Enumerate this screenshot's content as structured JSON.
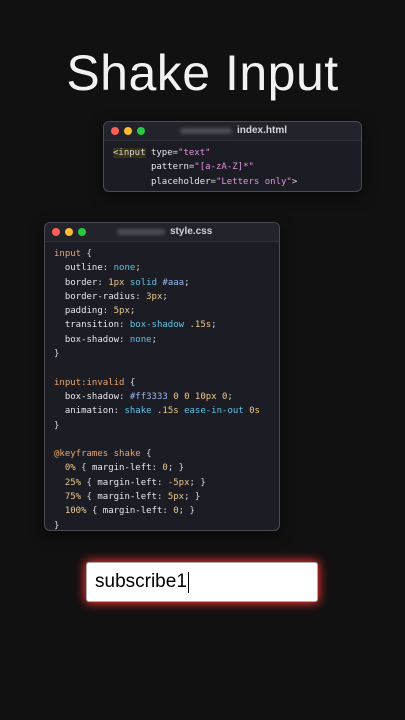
{
  "title": "Shake Input",
  "html_window": {
    "filename": "index.html",
    "lines": [
      [
        [
          "tag",
          "<input"
        ],
        [
          "plain",
          " "
        ],
        [
          "attr",
          "type"
        ],
        [
          "plain",
          "="
        ],
        [
          "str",
          "\"text\""
        ]
      ],
      [
        [
          "plain",
          "       "
        ],
        [
          "attr",
          "pattern"
        ],
        [
          "plain",
          "="
        ],
        [
          "str",
          "\"[a-zA-Z]*\""
        ]
      ],
      [
        [
          "plain",
          "       "
        ],
        [
          "attr",
          "placeholder"
        ],
        [
          "plain",
          "="
        ],
        [
          "str",
          "\"Letters only\""
        ],
        [
          "plain",
          ">"
        ]
      ]
    ]
  },
  "css_window": {
    "filename": "style.css",
    "lines": [
      [
        [
          "sel",
          "input"
        ],
        [
          "plain",
          " {"
        ]
      ],
      [
        [
          "plain",
          "  "
        ],
        [
          "prop",
          "outline"
        ],
        [
          "plain",
          ": "
        ],
        [
          "val",
          "none"
        ],
        [
          "plain",
          ";"
        ]
      ],
      [
        [
          "plain",
          "  "
        ],
        [
          "prop",
          "border"
        ],
        [
          "plain",
          ": "
        ],
        [
          "num",
          "1px"
        ],
        [
          "plain",
          " "
        ],
        [
          "val",
          "solid"
        ],
        [
          "plain",
          " "
        ],
        [
          "hex",
          "#aaa"
        ],
        [
          "plain",
          ";"
        ]
      ],
      [
        [
          "plain",
          "  "
        ],
        [
          "prop",
          "border-radius"
        ],
        [
          "plain",
          ": "
        ],
        [
          "num",
          "3px"
        ],
        [
          "plain",
          ";"
        ]
      ],
      [
        [
          "plain",
          "  "
        ],
        [
          "prop",
          "padding"
        ],
        [
          "plain",
          ": "
        ],
        [
          "num",
          "5px"
        ],
        [
          "plain",
          ";"
        ]
      ],
      [
        [
          "plain",
          "  "
        ],
        [
          "prop",
          "transition"
        ],
        [
          "plain",
          ": "
        ],
        [
          "val",
          "box-shadow"
        ],
        [
          "plain",
          " "
        ],
        [
          "num",
          ".15s"
        ],
        [
          "plain",
          ";"
        ]
      ],
      [
        [
          "plain",
          "  "
        ],
        [
          "prop",
          "box-shadow"
        ],
        [
          "plain",
          ": "
        ],
        [
          "val",
          "none"
        ],
        [
          "plain",
          ";"
        ]
      ],
      [
        [
          "plain",
          "}"
        ]
      ],
      [
        [
          "plain",
          ""
        ]
      ],
      [
        [
          "sel",
          "input:invalid"
        ],
        [
          "plain",
          " {"
        ]
      ],
      [
        [
          "plain",
          "  "
        ],
        [
          "prop",
          "box-shadow"
        ],
        [
          "plain",
          ": "
        ],
        [
          "hex",
          "#ff3333"
        ],
        [
          "plain",
          " "
        ],
        [
          "num",
          "0 0 10px 0"
        ],
        [
          "plain",
          ";"
        ]
      ],
      [
        [
          "plain",
          "  "
        ],
        [
          "prop",
          "animation"
        ],
        [
          "plain",
          ": "
        ],
        [
          "val",
          "shake"
        ],
        [
          "plain",
          " "
        ],
        [
          "num",
          ".15s"
        ],
        [
          "plain",
          " "
        ],
        [
          "val",
          "ease-in-out"
        ],
        [
          "plain",
          " "
        ],
        [
          "num",
          "0s"
        ]
      ],
      [
        [
          "plain",
          "}"
        ]
      ],
      [
        [
          "plain",
          ""
        ]
      ],
      [
        [
          "kw",
          "@keyframes shake"
        ],
        [
          "plain",
          " {"
        ]
      ],
      [
        [
          "plain",
          "  "
        ],
        [
          "num",
          "0%"
        ],
        [
          "plain",
          " { "
        ],
        [
          "prop",
          "margin-left"
        ],
        [
          "plain",
          ": "
        ],
        [
          "num",
          "0"
        ],
        [
          "plain",
          "; }"
        ]
      ],
      [
        [
          "plain",
          "  "
        ],
        [
          "num",
          "25%"
        ],
        [
          "plain",
          " { "
        ],
        [
          "prop",
          "margin-left"
        ],
        [
          "plain",
          ": "
        ],
        [
          "num",
          "-5px"
        ],
        [
          "plain",
          "; }"
        ]
      ],
      [
        [
          "plain",
          "  "
        ],
        [
          "num",
          "75%"
        ],
        [
          "plain",
          " { "
        ],
        [
          "prop",
          "margin-left"
        ],
        [
          "plain",
          ": "
        ],
        [
          "num",
          "5px"
        ],
        [
          "plain",
          "; }"
        ]
      ],
      [
        [
          "plain",
          "  "
        ],
        [
          "num",
          "100%"
        ],
        [
          "plain",
          " { "
        ],
        [
          "prop",
          "margin-left"
        ],
        [
          "plain",
          ": "
        ],
        [
          "num",
          "0"
        ],
        [
          "plain",
          "; }"
        ]
      ],
      [
        [
          "plain",
          "}"
        ]
      ]
    ]
  },
  "demo_input": {
    "value": "subscribe1",
    "glow_color": "#ff3333"
  }
}
